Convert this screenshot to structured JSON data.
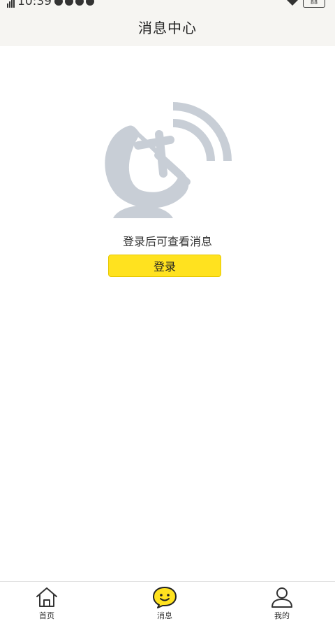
{
  "status_bar": {
    "time": "10:39",
    "battery": "88"
  },
  "header": {
    "title": "消息中心"
  },
  "empty_state": {
    "message": "登录后可查看消息",
    "login_label": "登录"
  },
  "tab_bar": {
    "items": [
      {
        "label": "首页",
        "icon": "home-icon"
      },
      {
        "label": "消息",
        "icon": "message-icon",
        "active": true
      },
      {
        "label": "我的",
        "icon": "user-icon"
      }
    ]
  },
  "colors": {
    "accent": "#ffe21f",
    "illustration": "#c8ced6"
  }
}
